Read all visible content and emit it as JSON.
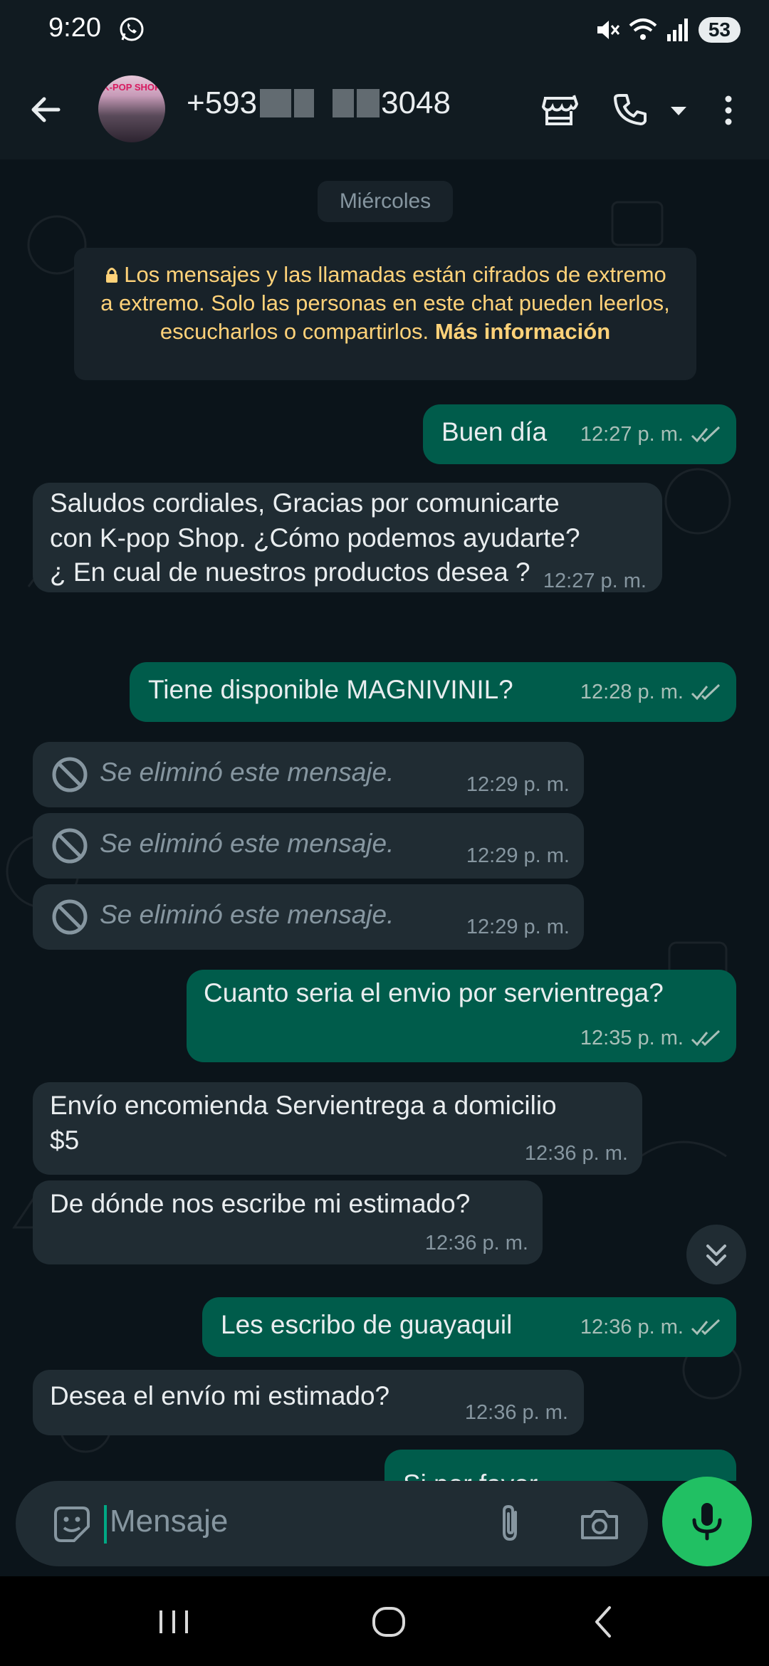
{
  "status_bar": {
    "time": "9:20",
    "battery": "53"
  },
  "header": {
    "contact_prefix": "+593",
    "contact_suffix": "3048",
    "avatar_text": "K-POP SHOP"
  },
  "chat": {
    "date_chip": "Miércoles",
    "encryption_notice": "Los mensajes y las llamadas están cifrados de extremo a extremo. Solo las personas en este chat pueden leerlos, escucharlos o compartirlos.",
    "encryption_link": "Más información",
    "messages": [
      {
        "dir": "out",
        "lines": [
          "Buen día"
        ],
        "time": "12:27 p. m."
      },
      {
        "dir": "in",
        "lines": [
          "Saludos cordiales, Gracias por comunicarte",
          "con K-pop Shop. ¿Cómo podemos ayudarte?",
          "¿ En cual de nuestros productos desea ?"
        ],
        "time": "12:27 p. m."
      },
      {
        "dir": "out",
        "lines": [
          "Tiene disponible MAGNIVINIL?"
        ],
        "time": "12:28 p. m."
      },
      {
        "dir": "in",
        "deleted": true,
        "lines": [
          "Se eliminó este mensaje."
        ],
        "time": "12:29 p. m."
      },
      {
        "dir": "in",
        "deleted": true,
        "lines": [
          "Se eliminó este mensaje."
        ],
        "time": "12:29 p. m."
      },
      {
        "dir": "in",
        "deleted": true,
        "lines": [
          "Se eliminó este mensaje."
        ],
        "time": "12:29 p. m."
      },
      {
        "dir": "out",
        "lines": [
          "Cuanto seria el envio por servientrega?"
        ],
        "time": "12:35 p. m."
      },
      {
        "dir": "in",
        "lines": [
          "Envío encomienda Servientrega a domicilio",
          "$5"
        ],
        "time": "12:36 p. m."
      },
      {
        "dir": "in",
        "lines": [
          "De dónde nos escribe mi estimado?"
        ],
        "time": "12:36 p. m."
      },
      {
        "dir": "out",
        "lines": [
          "Les escribo  de guayaquil"
        ],
        "time": "12:36 p. m."
      },
      {
        "dir": "in",
        "lines": [
          "Desea el envío mi estimado?"
        ],
        "time": "12:36 p. m."
      },
      {
        "dir": "out",
        "lines": [
          "Si por favor"
        ],
        "time": ""
      }
    ]
  },
  "composer": {
    "placeholder": "Mensaje"
  },
  "colors": {
    "outgoing": "#005c4b",
    "incoming": "#202c33",
    "accent": "#21c063",
    "notice_text": "#ffd279"
  },
  "icons": [
    "whatsapp-icon",
    "mute-icon",
    "wifi-icon",
    "signal-icon",
    "back-arrow-icon",
    "store-icon",
    "call-icon",
    "dropdown-icon",
    "more-icon",
    "lock-icon",
    "deleted-icon",
    "double-check-icon",
    "scroll-down-icon",
    "emoji-icon",
    "attach-icon",
    "camera-icon",
    "mic-icon",
    "recents-icon",
    "home-icon",
    "nav-back-icon"
  ]
}
